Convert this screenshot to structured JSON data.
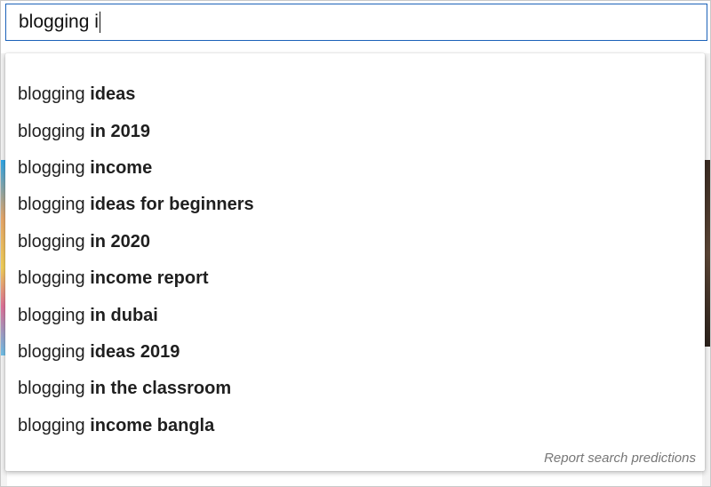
{
  "search": {
    "query": "blogging i"
  },
  "suggestions": [
    {
      "typed": "blogging ",
      "completion": "ideas"
    },
    {
      "typed": "blogging ",
      "completion": "in 2019"
    },
    {
      "typed": "blogging ",
      "completion": "income"
    },
    {
      "typed": "blogging ",
      "completion": "ideas for beginners"
    },
    {
      "typed": "blogging ",
      "completion": "in 2020"
    },
    {
      "typed": "blogging ",
      "completion": "income report"
    },
    {
      "typed": "blogging ",
      "completion": "in dubai"
    },
    {
      "typed": "blogging ",
      "completion": "ideas 2019"
    },
    {
      "typed": "blogging ",
      "completion": "in the classroom"
    },
    {
      "typed": "blogging ",
      "completion": "income bangla"
    }
  ],
  "footer": {
    "report_label": "Report search predictions"
  },
  "colors": {
    "focus_border": "#1c62b9",
    "report_text": "#777777"
  }
}
